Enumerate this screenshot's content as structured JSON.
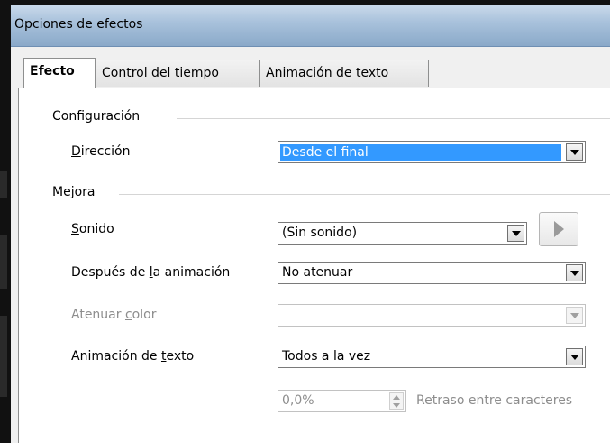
{
  "window": {
    "title": "Opciones de efectos"
  },
  "tabs": [
    {
      "label": "Efecto",
      "active": true
    },
    {
      "label": "Control del tiempo",
      "active": false
    },
    {
      "label": "Animación de texto",
      "active": false
    }
  ],
  "config": {
    "group_label": "Configuración",
    "direccion": {
      "label_pre": "",
      "label_u": "D",
      "label_post": "irección",
      "value": "Desde el final"
    }
  },
  "mejora": {
    "group_label": "Mejora",
    "sonido": {
      "label_u": "S",
      "label_post": "onido",
      "value": "(Sin sonido)"
    },
    "despues": {
      "label_pre": "Después de ",
      "label_u": "l",
      "label_post": "a animación",
      "value": "No atenuar"
    },
    "atenuar": {
      "label_pre": "Atenuar ",
      "label_u": "c",
      "label_post": "olor",
      "value": ""
    },
    "animacion_texto": {
      "label_pre": "Animación de ",
      "label_u": "t",
      "label_post": "exto",
      "value": "Todos a la vez"
    },
    "retraso": {
      "value": "0,0%",
      "label": "Retraso entre caracteres"
    }
  }
}
